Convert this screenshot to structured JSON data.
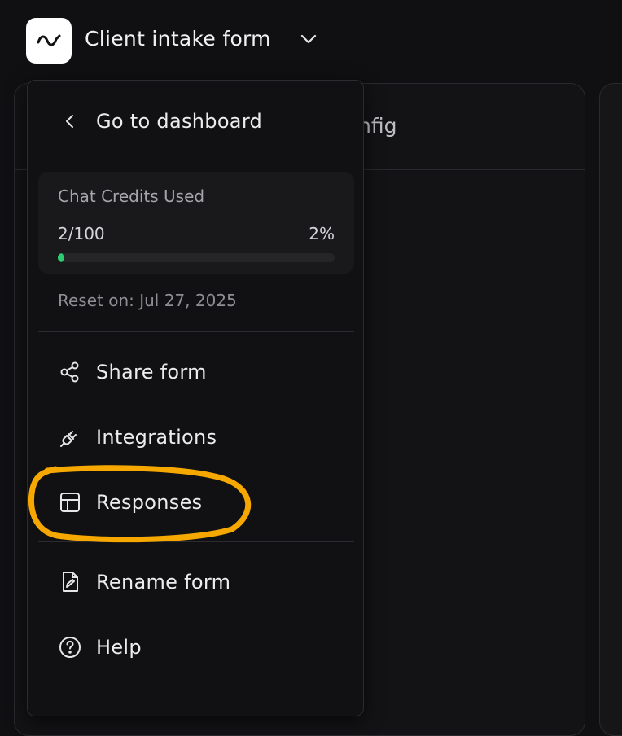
{
  "header": {
    "form_title": "Client intake form",
    "logo_icon": "wave-logo-icon",
    "chevron_icon": "chevron-down-icon"
  },
  "background": {
    "tab_label": "nfig"
  },
  "menu": {
    "back": {
      "label": "Go to dashboard",
      "icon": "chevron-left-icon"
    },
    "credits": {
      "title": "Chat Credits Used",
      "count": "2/100",
      "percent_label": "2%",
      "fraction_used": 0.02,
      "bar_color": "#2ecc71"
    },
    "reset_text": "Reset on: Jul 27, 2025",
    "items": [
      {
        "label": "Share form",
        "icon": "share-icon"
      },
      {
        "label": "Integrations",
        "icon": "plug-icon"
      },
      {
        "label": "Responses",
        "icon": "table-icon"
      },
      {
        "label": "Rename form",
        "icon": "file-edit-icon"
      },
      {
        "label": "Help",
        "icon": "help-circle-icon"
      }
    ]
  },
  "annotation": {
    "highlight_color": "#f7a800",
    "highlight_target": "Responses"
  }
}
